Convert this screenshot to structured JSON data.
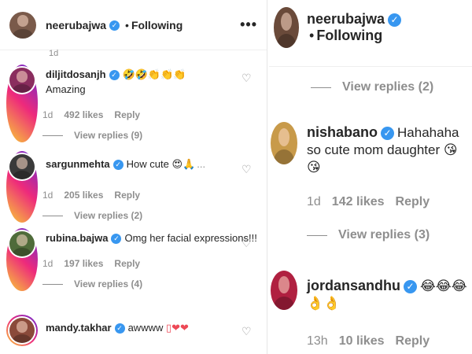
{
  "left": {
    "header": {
      "username": "neerubajwa",
      "following": "Following",
      "more": "•••",
      "avatar_color": "#7a5a4a"
    },
    "top_timestamp": "1d",
    "comments": [
      {
        "username": "diljitdosanjh",
        "text_prefix": "",
        "emojis": "🤣🤣👏👏👏",
        "text": "Amazing",
        "time": "1d",
        "likes": "492 likes",
        "reply": "Reply",
        "view_replies": "View replies (9)",
        "avatar_color": "#8a2d5e"
      },
      {
        "username": "sargunmehta",
        "text": "How cute",
        "emojis": "😍🙏",
        "time": "1d",
        "likes": "205 likes",
        "reply": "Reply",
        "view_replies": "View replies (2)",
        "avatar_color": "#3a3a3a"
      },
      {
        "username": "rubina.bajwa",
        "text": "Omg her facial expressions!!!",
        "time": "1d",
        "likes": "197 likes",
        "reply": "Reply",
        "view_replies": "View replies (4)",
        "avatar_color": "#4f6b3a"
      },
      {
        "username": "mandy.takhar",
        "text": "awwww",
        "emojis": "▯❤❤",
        "avatar_color": "#8a4a3a"
      }
    ]
  },
  "right": {
    "header": {
      "username": "neerubajwa",
      "following": "Following",
      "avatar_color": "#6a4a3a"
    },
    "top_view_replies": "View replies (2)",
    "comments": [
      {
        "username": "nishabano",
        "text": "Hahahaha so cute mom daughter",
        "emojis": "😘😘",
        "time": "1d",
        "likes": "142 likes",
        "reply": "Reply",
        "view_replies": "View replies (3)",
        "avatar_color": "#c89a4a"
      },
      {
        "username": "jordansandhu",
        "emojis": "😂😂😂👌👌",
        "time": "13h",
        "likes": "10 likes",
        "reply": "Reply",
        "avatar_color": "#b02040"
      }
    ]
  },
  "colors": {
    "verified": "#3897f0",
    "muted": "#8e8e8e",
    "text": "#262626",
    "heart_red": "#ed4956"
  }
}
